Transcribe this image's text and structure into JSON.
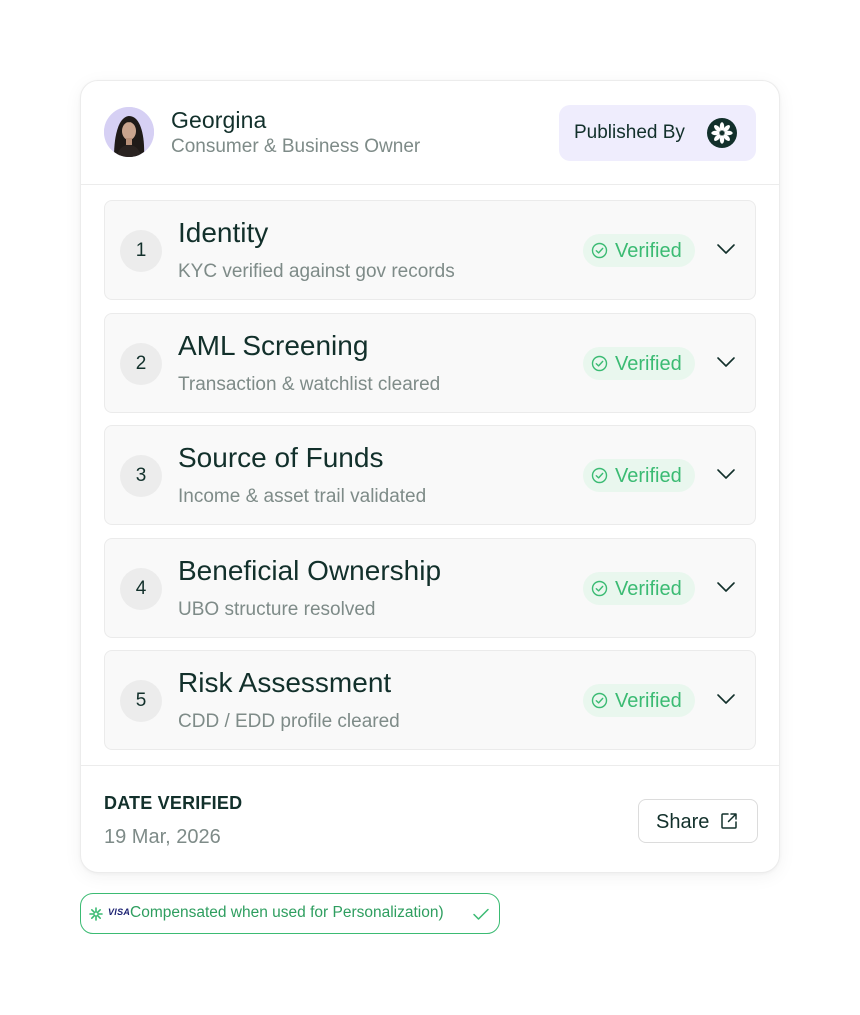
{
  "profile": {
    "name": "Georgina",
    "role": "Consumer & Business Owner",
    "published_label": "Published By"
  },
  "steps": [
    {
      "number": "1",
      "title": "Identity",
      "subtitle": "KYC verified against gov records",
      "status": "Verified"
    },
    {
      "number": "2",
      "title": "AML Screening",
      "subtitle": "Transaction & watchlist cleared",
      "status": "Verified"
    },
    {
      "number": "3",
      "title": "Source of Funds",
      "subtitle": "Income & asset trail validated",
      "status": "Verified"
    },
    {
      "number": "4",
      "title": "Beneficial Ownership",
      "subtitle": "UBO structure resolved",
      "status": "Verified"
    },
    {
      "number": "5",
      "title": "Risk Assessment",
      "subtitle": "CDD / EDD profile cleared",
      "status": "Verified"
    }
  ],
  "footer": {
    "date_label": "DATE VERIFIED",
    "date_value": "19 Mar, 2026",
    "share_label": "Share"
  },
  "consent": {
    "brand": "VISA",
    "text": "Compensated when used for Personalization)"
  },
  "colors": {
    "verified_green": "#3bbb73",
    "verified_bg": "#e9f7ee",
    "published_bg": "#efedfd",
    "text_dark": "#12302b",
    "text_muted": "#7e8b88"
  },
  "icons": {
    "avatar": "user-avatar",
    "publisher_logo": "starburst-logo-icon",
    "status": "check-circle-icon",
    "expand": "chevron-down-icon",
    "share": "external-link-icon",
    "consent_check": "check-icon"
  }
}
